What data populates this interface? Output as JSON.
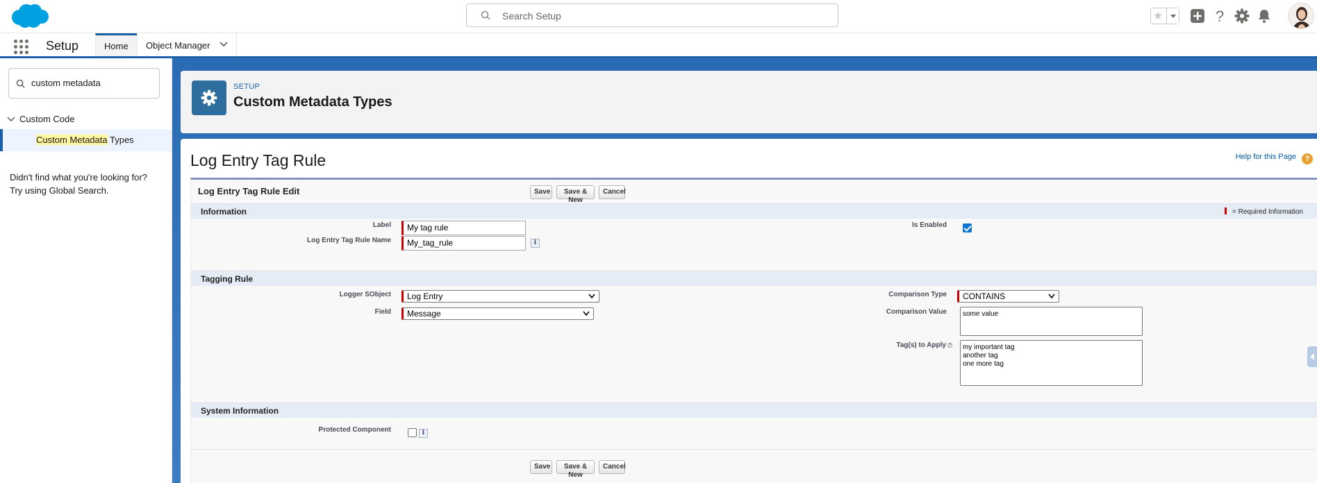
{
  "header": {
    "search_placeholder": "Search Setup"
  },
  "context_bar": {
    "app_name": "Setup",
    "tabs": [
      {
        "label": "Home"
      },
      {
        "label": "Object Manager"
      }
    ]
  },
  "nav": {
    "quick_find_value": "custom metadata",
    "group_label": "Custom Code",
    "item_highlight": "Custom Metadata",
    "item_rest": " Types",
    "help_line1": "Didn't find what you're looking for?",
    "help_line2": "Try using Global Search."
  },
  "page_header": {
    "breadcrumb": "SETUP",
    "title": "Custom Metadata Types"
  },
  "content": {
    "title": "Log Entry Tag Rule",
    "help_link": "Help for this Page",
    "help_icon": "?"
  },
  "edit_block": {
    "title": "Log Entry Tag Rule Edit",
    "buttons": {
      "save": "Save",
      "save_new": "Save & New",
      "cancel": "Cancel"
    },
    "required_legend": "= Required Information",
    "sections": {
      "information": "Information",
      "tagging_rule": "Tagging Rule",
      "system_information": "System Information"
    },
    "fields": {
      "label": {
        "label": "Label",
        "value": "My tag rule"
      },
      "name": {
        "label": "Log Entry Tag Rule Name",
        "value": "My_tag_rule"
      },
      "is_enabled": {
        "label": "Is Enabled",
        "checked": true
      },
      "logger_sobject": {
        "label": "Logger SObject",
        "value": "Log Entry"
      },
      "field": {
        "label": "Field",
        "value": "Message"
      },
      "comparison_type": {
        "label": "Comparison Type",
        "value": "CONTAINS"
      },
      "comparison_value": {
        "label": "Comparison Value",
        "value": "some value"
      },
      "tags_to_apply": {
        "label": "Tag(s) to Apply",
        "value": "my important tag\nanother tag\none more tag"
      },
      "protected_component": {
        "label": "Protected Component",
        "checked": false
      }
    },
    "info_glyph": "i",
    "tip_glyph": "?"
  },
  "colors": {
    "brand_blue": "#1b5fa6",
    "required_red": "#cc0000",
    "section_bg": "#e5ecf5"
  },
  "icons": [
    "salesforce-cloud-logo",
    "search-icon",
    "favorite-star-icon",
    "add-icon",
    "help-icon",
    "gear-icon",
    "bell-icon",
    "app-launcher-icon",
    "chevron-down-icon",
    "setup-gear-icon"
  ]
}
